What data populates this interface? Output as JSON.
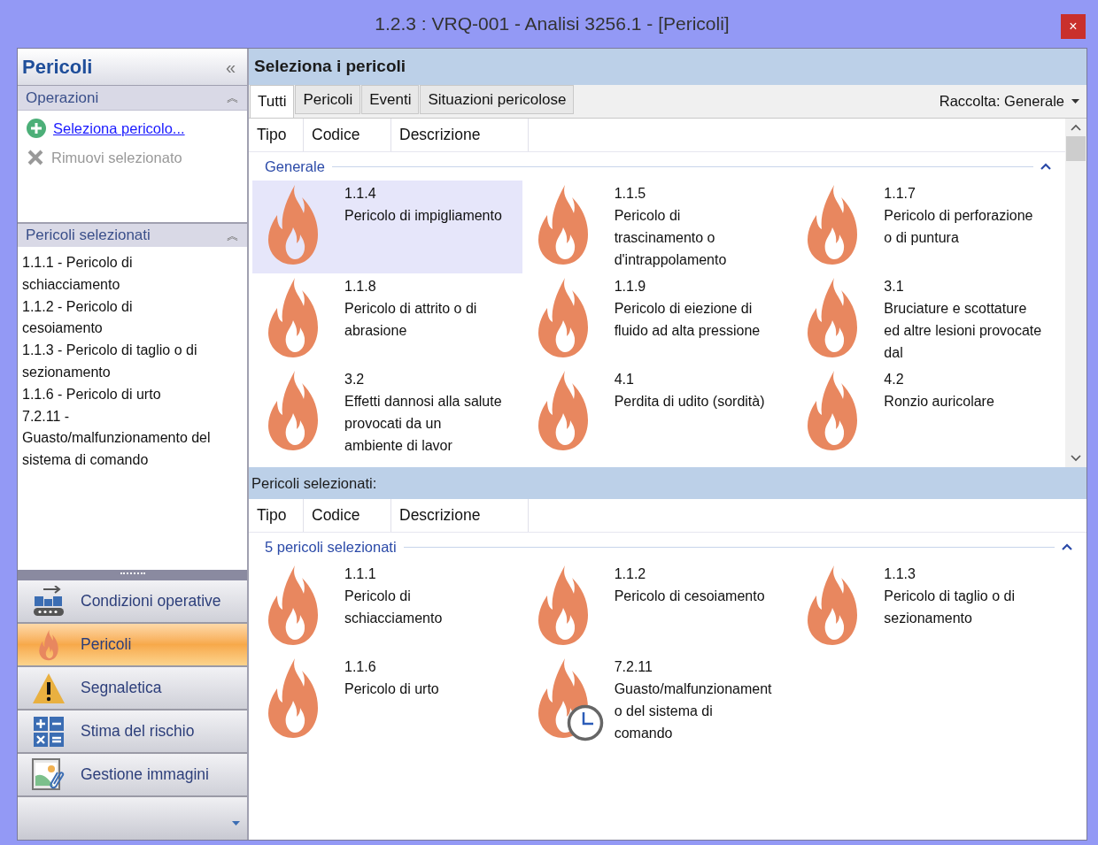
{
  "window": {
    "title": "1.2.3 : VRQ-001 - Analisi 3256.1 - [Pericoli]",
    "close": "×"
  },
  "sidebar": {
    "title": "Pericoli",
    "collapse": "«",
    "operations": {
      "title": "Operazioni",
      "collapse": "︽",
      "items": [
        {
          "kind": "add",
          "label": "Seleziona pericolo...",
          "disabled": false
        },
        {
          "kind": "remove",
          "label": "Rimuovi selezionato",
          "disabled": true
        }
      ]
    },
    "selected": {
      "title": "Pericoli selezionati",
      "collapse": "︽",
      "items": [
        "1.1.1 - Pericolo di schiacciamento",
        "1.1.2 - Pericolo di cesoiamento",
        "1.1.3 - Pericolo di taglio o di sezionamento",
        "1.1.6 - Pericolo di urto",
        "7.2.11 - Guasto/malfunzionamento del sistema di comando"
      ]
    },
    "nav": [
      {
        "kind": "conveyor",
        "label": "Condizioni operative",
        "selected": false
      },
      {
        "kind": "flame",
        "label": "Pericoli",
        "selected": true
      },
      {
        "kind": "warning",
        "label": "Segnaletica",
        "selected": false
      },
      {
        "kind": "calculator",
        "label": "Stima del rischio",
        "selected": false
      },
      {
        "kind": "image",
        "label": "Gestione immagini",
        "selected": false
      }
    ]
  },
  "main": {
    "title": "Seleziona i pericoli",
    "tabs": [
      {
        "label": "Tutti",
        "selected": true
      },
      {
        "label": "Pericoli",
        "selected": false
      },
      {
        "label": "Eventi",
        "selected": false
      },
      {
        "label": "Situazioni pericolose",
        "selected": false
      }
    ],
    "collection": "Raccolta: Generale",
    "columns": [
      "Tipo",
      "Codice",
      "Descrizione"
    ],
    "group": {
      "title": "Generale",
      "expanded": true
    },
    "items": [
      {
        "code": "1.1.4",
        "text": "Pericolo di impigliamento",
        "selected": true
      },
      {
        "code": "1.1.5",
        "text": "Pericolo di trascinamento o d'intrappolamento",
        "selected": false
      },
      {
        "code": "1.1.7",
        "text": "Pericolo di perforazione o di puntura",
        "selected": false
      },
      {
        "code": "1.1.8",
        "text": "Pericolo di attrito o di abrasione",
        "selected": false
      },
      {
        "code": "1.1.9",
        "text": "Pericolo di eiezione di fluido ad alta pressione",
        "selected": false
      },
      {
        "code": "3.1",
        "text": "Bruciature e scottature ed altre lesioni provocate dal",
        "selected": false
      },
      {
        "code": "3.2",
        "text": "Effetti dannosi alla salute provocati da un ambiente di lavor",
        "selected": false
      },
      {
        "code": "4.1",
        "text": "Perdita di udito (sordità)",
        "selected": false
      },
      {
        "code": "4.2",
        "text": "Ronzio auricolare",
        "selected": false
      }
    ]
  },
  "selected_panel": {
    "title": "Pericoli selezionati:",
    "columns": [
      "Tipo",
      "Codice",
      "Descrizione"
    ],
    "group": {
      "title": "5 pericoli selezionati",
      "expanded": true
    },
    "items": [
      {
        "code": "1.1.1",
        "text": "Pericolo di schiacciamento",
        "clock": false
      },
      {
        "code": "1.1.2",
        "text": "Pericolo di cesoiamento",
        "clock": false
      },
      {
        "code": "1.1.3",
        "text": "Pericolo di taglio o di sezionamento",
        "clock": false
      },
      {
        "code": "1.1.6",
        "text": "Pericolo di urto",
        "clock": false
      },
      {
        "code": "7.2.11",
        "text": "Guasto/malfunzionamento del sistema di comando",
        "clock": true
      }
    ]
  }
}
